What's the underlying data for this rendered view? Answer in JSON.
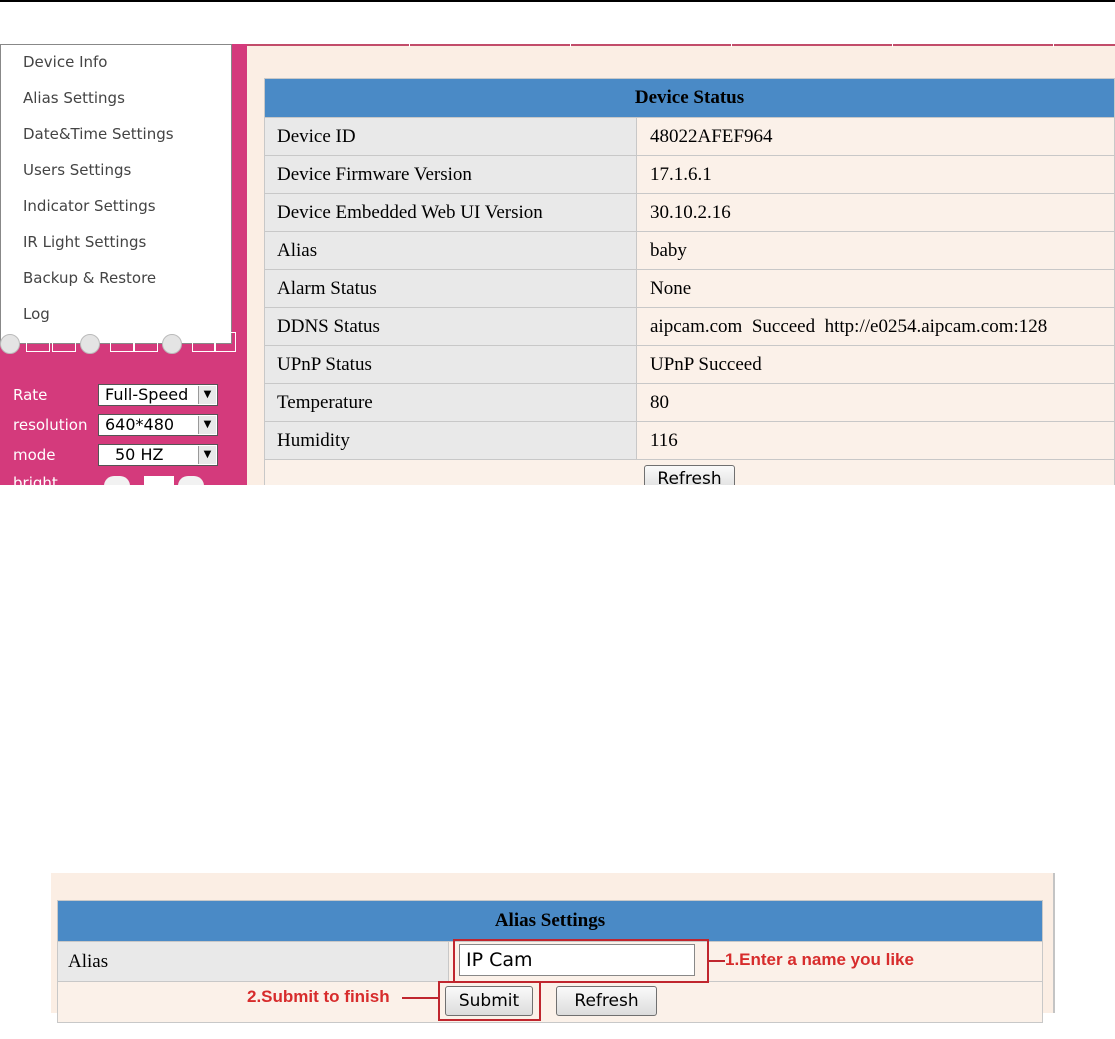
{
  "menu": {
    "items": [
      {
        "label": "Device Info"
      },
      {
        "label": "Alias Settings"
      },
      {
        "label": "Date&Time Settings"
      },
      {
        "label": "Users Settings"
      },
      {
        "label": "Indicator Settings"
      },
      {
        "label": "IR Light Settings"
      },
      {
        "label": "Backup & Restore"
      },
      {
        "label": "Log"
      }
    ]
  },
  "controls": {
    "rate": {
      "label": "Rate",
      "value": "Full-Speed"
    },
    "resolution": {
      "label": "resolution",
      "value": "640*480"
    },
    "mode": {
      "label": "mode",
      "value": "50 HZ"
    },
    "bright": {
      "label": "bright"
    }
  },
  "device_status": {
    "title": "Device Status",
    "rows": [
      {
        "label": "Device ID",
        "value": "48022AFEF964"
      },
      {
        "label": "Device Firmware Version",
        "value": "17.1.6.1"
      },
      {
        "label": "Device Embedded Web UI Version",
        "value": "30.10.2.16"
      },
      {
        "label": "Alias",
        "value": "baby"
      },
      {
        "label": "Alarm Status",
        "value": "None"
      },
      {
        "label": "DDNS Status",
        "value": "aipcam.com  Succeed  http://e0254.aipcam.com:128"
      },
      {
        "label": "UPnP Status",
        "value": "UPnP Succeed"
      },
      {
        "label": "Temperature",
        "value": "80"
      },
      {
        "label": "Humidity",
        "value": "116"
      }
    ],
    "refresh_label": "Refresh"
  },
  "alias_settings": {
    "title": "Alias Settings",
    "alias_label": "Alias",
    "alias_value": "IP Cam",
    "submit_label": "Submit",
    "refresh_label": "Refresh",
    "annotation_1": "1.Enter a name you like",
    "annotation_2": "2.Submit to finish"
  },
  "colors": {
    "sidebar": "#d43a7c",
    "header": "#4a8ac6",
    "content_bg": "#fbeee4",
    "annotation": "#d72c2c"
  }
}
